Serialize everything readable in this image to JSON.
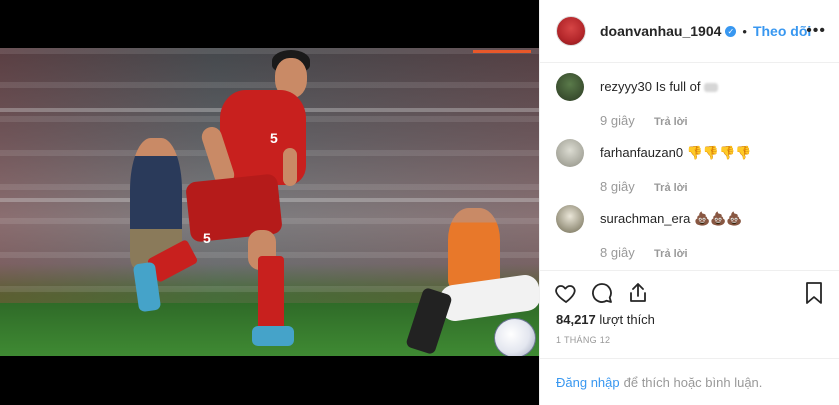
{
  "post": {
    "username": "doanvanhau_1904",
    "follow_label": "Theo dõi",
    "separator": "•",
    "more_label": "•••"
  },
  "comments": [
    {
      "user": "rezyyy30",
      "text": "Is full of",
      "time": "9 giây",
      "reply": "Trả lời"
    },
    {
      "user": "farhanfauzan0",
      "text": "👎👎👎👎",
      "time": "8 giây",
      "reply": "Trả lời"
    },
    {
      "user": "surachman_era",
      "text": "💩💩💩",
      "time": "8 giây",
      "reply": "Trả lời"
    }
  ],
  "likes": {
    "count": "84,217",
    "label": "lượt thích"
  },
  "date": "1 THÁNG 12",
  "login": {
    "link": "Đăng nhập",
    "rest": "để thích hoặc bình luận."
  },
  "photo": {
    "jersey_number": "5"
  },
  "icons": {
    "like": "heart-icon",
    "comment": "comment-icon",
    "share": "share-icon",
    "save": "bookmark-icon",
    "verified": "verified-badge-icon"
  },
  "colors": {
    "accent": "#3897f0",
    "jersey": "#c8201e"
  }
}
